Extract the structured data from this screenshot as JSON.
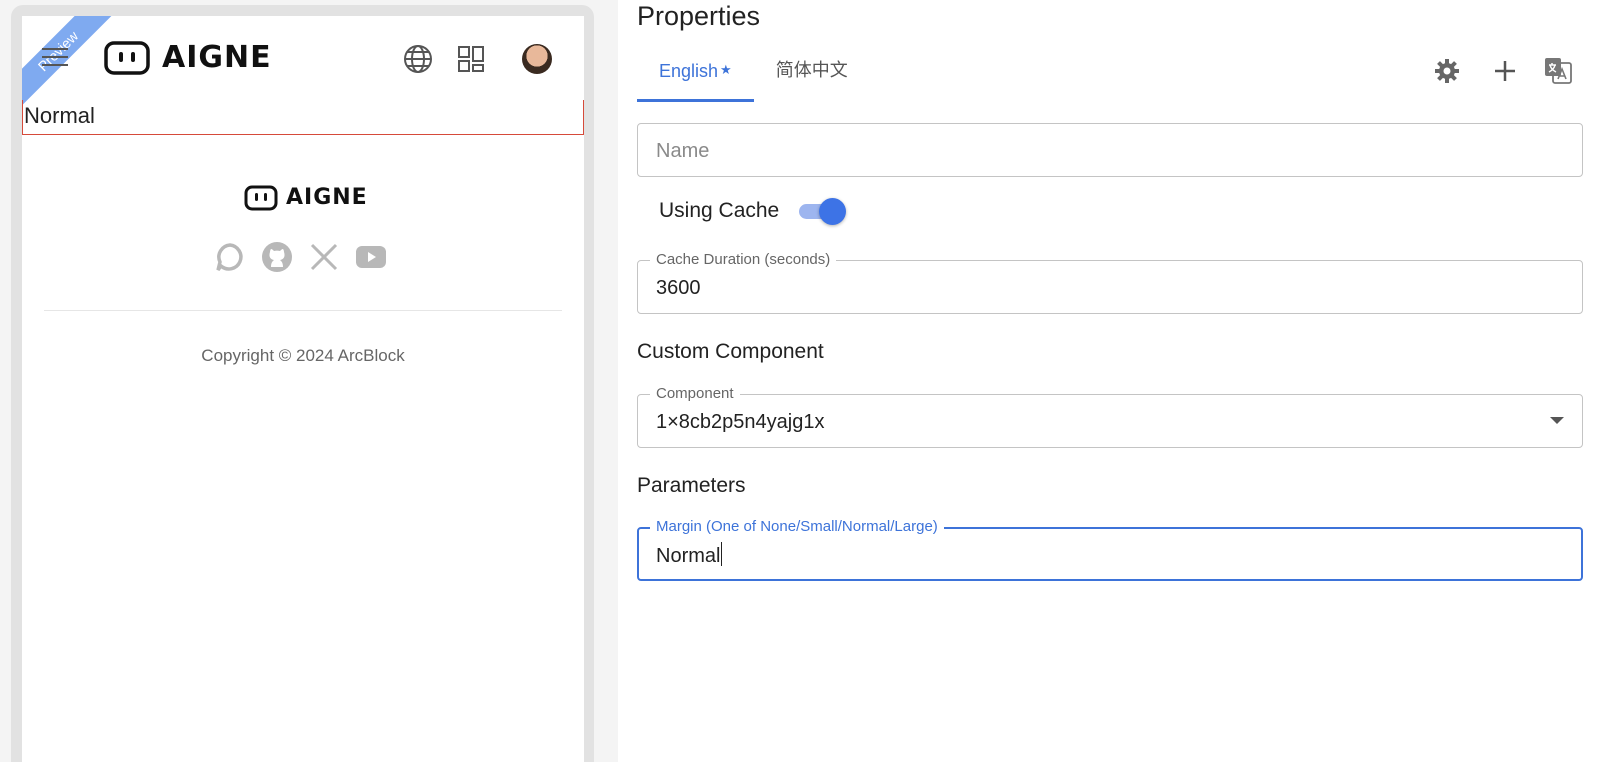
{
  "preview": {
    "ribbon_label": "Preview",
    "brand_name": "AIGNE",
    "rendered_text": "Normal",
    "footer_brand_name": "AIGNE",
    "copyright": "Copyright © 2024 ArcBlock"
  },
  "properties": {
    "title": "Properties",
    "tabs": [
      {
        "label": "English",
        "marker": "★",
        "active": true
      },
      {
        "label": "简体中文",
        "active": false
      }
    ],
    "name_field": {
      "placeholder": "Name"
    },
    "cache_toggle": {
      "label": "Using Cache",
      "enabled": true
    },
    "cache_duration": {
      "label": "Cache Duration (seconds)",
      "value": "3600"
    },
    "custom_component_heading": "Custom Component",
    "component_field": {
      "label": "Component",
      "value": "1×8cb2p5n4yajg1x"
    },
    "parameters_heading": "Parameters",
    "margin_field": {
      "label": "Margin (One of None/Small/Normal/Large)",
      "value": "Normal"
    }
  },
  "icons": {
    "menu": "hamburger-menu-icon",
    "language": "globe-icon",
    "apps": "grid-icon",
    "social": [
      "chat-icon",
      "github-icon",
      "x-icon",
      "youtube-icon"
    ],
    "toolbar": [
      "gear-icon",
      "plus-icon",
      "translate-icon"
    ]
  },
  "colors": {
    "accent": "#3d73d9",
    "ribbon": "#7faaf0",
    "error_border": "#d64a3a"
  }
}
